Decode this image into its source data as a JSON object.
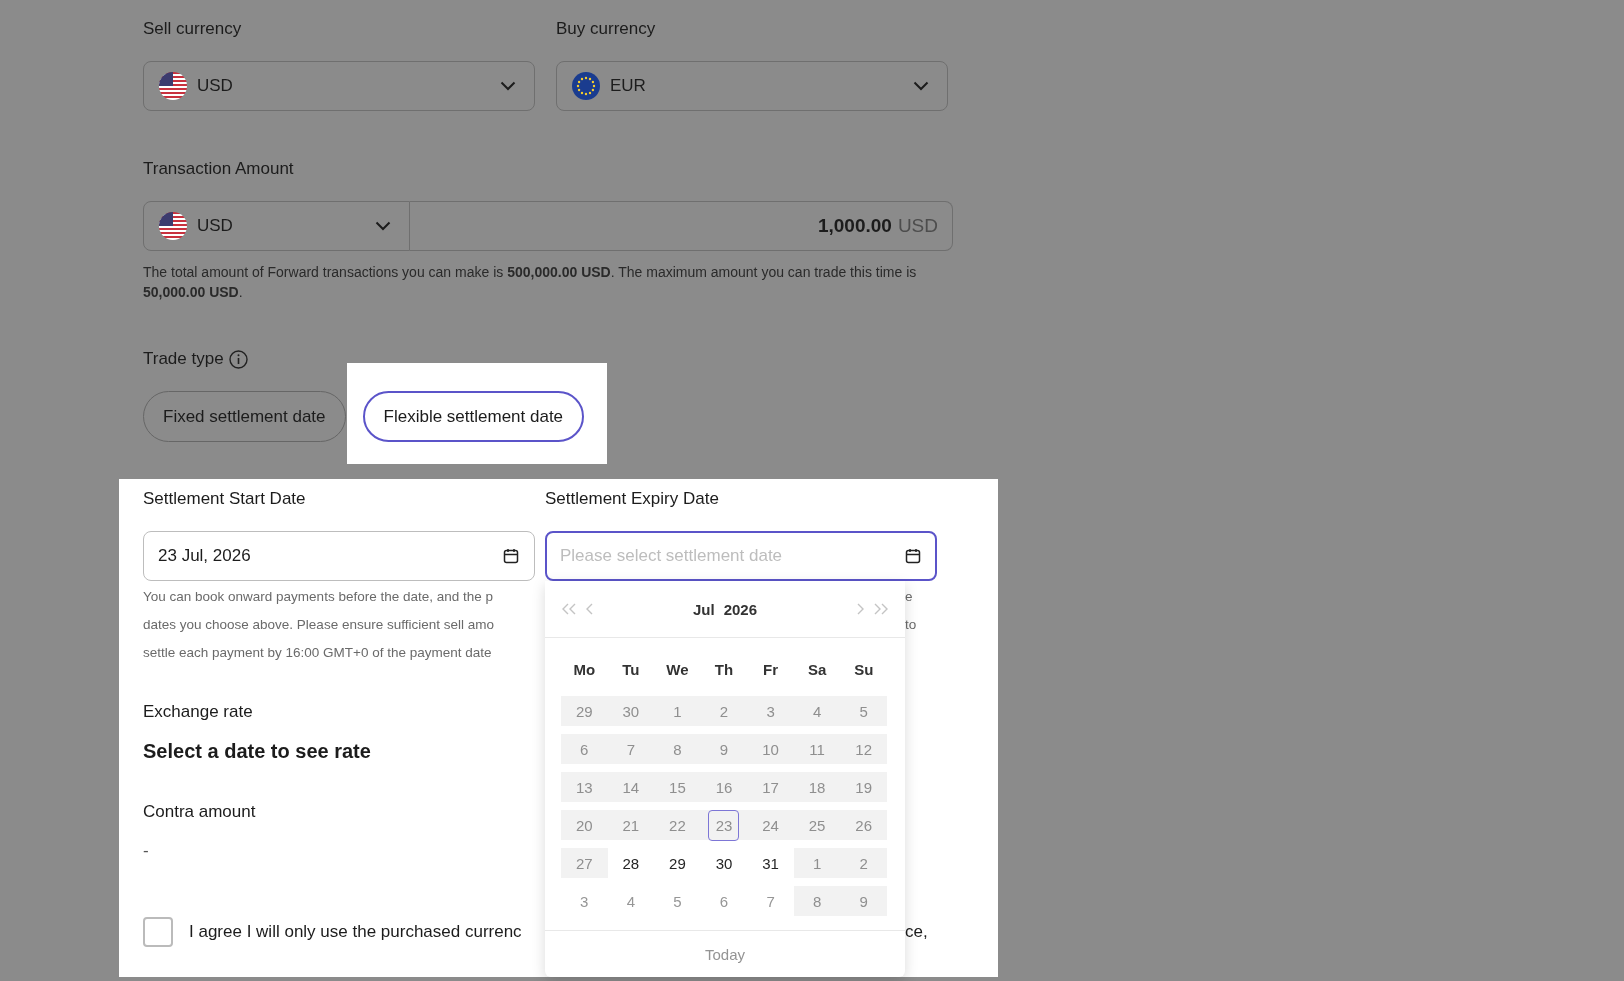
{
  "sell_currency": {
    "label": "Sell currency",
    "value": "USD"
  },
  "buy_currency": {
    "label": "Buy currency",
    "value": "EUR"
  },
  "transaction_amount": {
    "label": "Transaction Amount",
    "currency": "USD",
    "amount": "1,000.00",
    "unit": "USD"
  },
  "limit_note": "The total amount of Forward transactions you can make is **500,000.00 USD**. The maximum amount you can trade this time is **50,000.00 USD**.",
  "trade_type": {
    "label": "Trade type",
    "options": [
      {
        "label": "Fixed settlement date",
        "selected": false
      },
      {
        "label": "Flexible settlement date",
        "selected": true
      }
    ]
  },
  "settlement_start": {
    "label": "Settlement Start Date",
    "value": "23 Jul, 2026"
  },
  "settlement_expiry": {
    "label": "Settlement Expiry Date",
    "placeholder": "Please select settlement date",
    "focused": true
  },
  "settlement_note": [
    {
      "left": "You can book onward payments before the date, and the p",
      "right": "e"
    },
    {
      "left": "dates you choose above. Please ensure sufficient sell amo",
      "right": "to"
    },
    {
      "left": "settle each payment by 16:00 GMT+0 of the payment date"
    }
  ],
  "exchange_rate": {
    "label": "Exchange rate",
    "value": "Select a date to see rate"
  },
  "contra_amount": {
    "label": "Contra amount",
    "value": "-"
  },
  "agreement": {
    "checked": false,
    "text_left": "I agree I will only use the purchased currenc",
    "text_right": "ce,"
  },
  "date_picker": {
    "month": "Jul",
    "year": "2026",
    "weekdays": [
      "Mo",
      "Tu",
      "We",
      "Th",
      "Fr",
      "Sa",
      "Su"
    ],
    "weeks": [
      [
        {
          "d": "29",
          "kind": "disabled",
          "today": false
        },
        {
          "d": "30",
          "kind": "disabled",
          "today": false
        },
        {
          "d": "1",
          "kind": "disabled",
          "today": false
        },
        {
          "d": "2",
          "kind": "disabled",
          "today": false
        },
        {
          "d": "3",
          "kind": "disabled",
          "today": false
        },
        {
          "d": "4",
          "kind": "disabled",
          "today": false
        },
        {
          "d": "5",
          "kind": "disabled",
          "today": false
        }
      ],
      [
        {
          "d": "6",
          "kind": "disabled",
          "today": false
        },
        {
          "d": "7",
          "kind": "disabled",
          "today": false
        },
        {
          "d": "8",
          "kind": "disabled",
          "today": false
        },
        {
          "d": "9",
          "kind": "disabled",
          "today": false
        },
        {
          "d": "10",
          "kind": "disabled",
          "today": false
        },
        {
          "d": "11",
          "kind": "disabled",
          "today": false
        },
        {
          "d": "12",
          "kind": "disabled",
          "today": false
        }
      ],
      [
        {
          "d": "13",
          "kind": "disabled",
          "today": false
        },
        {
          "d": "14",
          "kind": "disabled",
          "today": false
        },
        {
          "d": "15",
          "kind": "disabled",
          "today": false
        },
        {
          "d": "16",
          "kind": "disabled",
          "today": false
        },
        {
          "d": "17",
          "kind": "disabled",
          "today": false
        },
        {
          "d": "18",
          "kind": "disabled",
          "today": false
        },
        {
          "d": "19",
          "kind": "disabled",
          "today": false
        }
      ],
      [
        {
          "d": "20",
          "kind": "disabled",
          "today": false
        },
        {
          "d": "21",
          "kind": "disabled",
          "today": false
        },
        {
          "d": "22",
          "kind": "disabled",
          "today": false
        },
        {
          "d": "23",
          "kind": "disabled",
          "today": true
        },
        {
          "d": "24",
          "kind": "disabled",
          "today": false
        },
        {
          "d": "25",
          "kind": "disabled",
          "today": false
        },
        {
          "d": "26",
          "kind": "disabled",
          "today": false
        }
      ],
      [
        {
          "d": "27",
          "kind": "disabled",
          "today": false
        },
        {
          "d": "28",
          "kind": "available",
          "today": false
        },
        {
          "d": "29",
          "kind": "available",
          "today": false
        },
        {
          "d": "30",
          "kind": "available",
          "today": false
        },
        {
          "d": "31",
          "kind": "available",
          "today": false
        },
        {
          "d": "1",
          "kind": "disabled",
          "today": false
        },
        {
          "d": "2",
          "kind": "disabled",
          "today": false
        }
      ],
      [
        {
          "d": "3",
          "kind": "other",
          "today": false
        },
        {
          "d": "4",
          "kind": "other",
          "today": false
        },
        {
          "d": "5",
          "kind": "other",
          "today": false
        },
        {
          "d": "6",
          "kind": "other",
          "today": false
        },
        {
          "d": "7",
          "kind": "other",
          "today": false
        },
        {
          "d": "8",
          "kind": "disabled",
          "today": false
        },
        {
          "d": "9",
          "kind": "disabled",
          "today": false
        }
      ]
    ],
    "footer": {
      "label": "Today",
      "disabled": true
    }
  }
}
